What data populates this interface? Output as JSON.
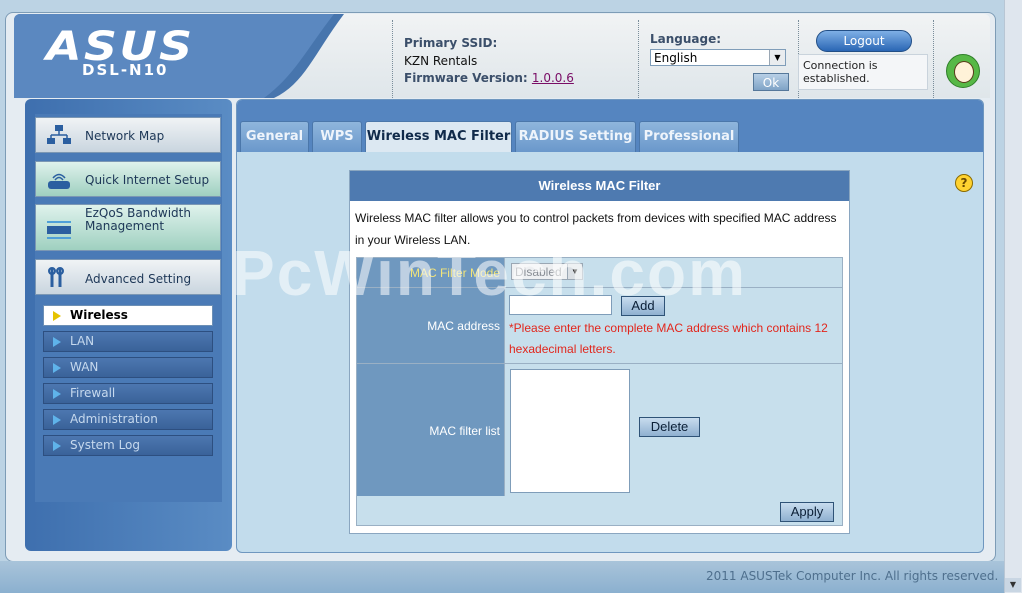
{
  "header": {
    "brand": "ASUS",
    "model": "DSL-N10",
    "primary_ssid_label": "Primary SSID:",
    "primary_ssid_value": "KZN Rentals",
    "firmware_label": "Firmware Version:",
    "firmware_value": "1.0.0.6",
    "language_label": "Language:",
    "language_value": "English",
    "ok_label": "Ok",
    "logout_label": "Logout",
    "status_text": "Connection is established."
  },
  "sidebar": {
    "main": [
      {
        "label": "Network Map",
        "icon": "network-map-icon"
      },
      {
        "label": "Quick Internet Setup",
        "icon": "router-icon"
      },
      {
        "label": "EzQoS Bandwidth Management",
        "icon": "qos-icon"
      },
      {
        "label": "Advanced Setting",
        "icon": "tools-icon"
      }
    ],
    "sub": [
      {
        "label": "Wireless",
        "active": true
      },
      {
        "label": "LAN"
      },
      {
        "label": "WAN"
      },
      {
        "label": "Firewall"
      },
      {
        "label": "Administration"
      },
      {
        "label": "System Log"
      }
    ]
  },
  "tabs": [
    {
      "label": "General"
    },
    {
      "label": "WPS"
    },
    {
      "label": "Wireless MAC Filter",
      "active": true
    },
    {
      "label": "RADIUS Setting"
    },
    {
      "label": "Professional"
    }
  ],
  "form": {
    "title": "Wireless MAC Filter",
    "description": "Wireless MAC filter allows you to control packets from devices with specified MAC address in your Wireless LAN.",
    "mode_label": "MAC Filter Mode",
    "mode_value": "Disabled",
    "mac_label": "MAC address",
    "mac_value": "",
    "add_label": "Add",
    "hint": "*Please enter the complete MAC address which contains 12 hexadecimal letters.",
    "list_label": "MAC filter list",
    "delete_label": "Delete",
    "apply_label": "Apply"
  },
  "footer": "2011 ASUSTek Computer Inc. All rights reserved.",
  "watermark": "PcWinTech.com",
  "colors": {
    "accent": "#4e7ab0",
    "hint": "#e2261c",
    "active_tab": "#dce8f2"
  }
}
